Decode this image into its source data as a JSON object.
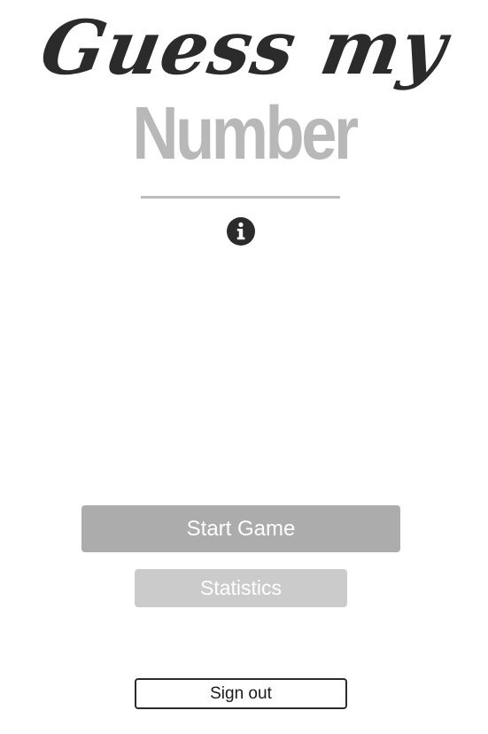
{
  "logo": {
    "line1": "Guess my",
    "line2": "Number"
  },
  "info": {
    "icon": "info-circle-icon"
  },
  "buttons": {
    "start_label": "Start Game",
    "statistics_label": "Statistics",
    "signout_label": "Sign out"
  },
  "colors": {
    "logo_dark": "#2b2b2b",
    "logo_light": "#b8b8b8",
    "start_bg": "#acacac",
    "statistics_bg": "#cbcbcb",
    "signout_border": "#2b2b2b"
  }
}
